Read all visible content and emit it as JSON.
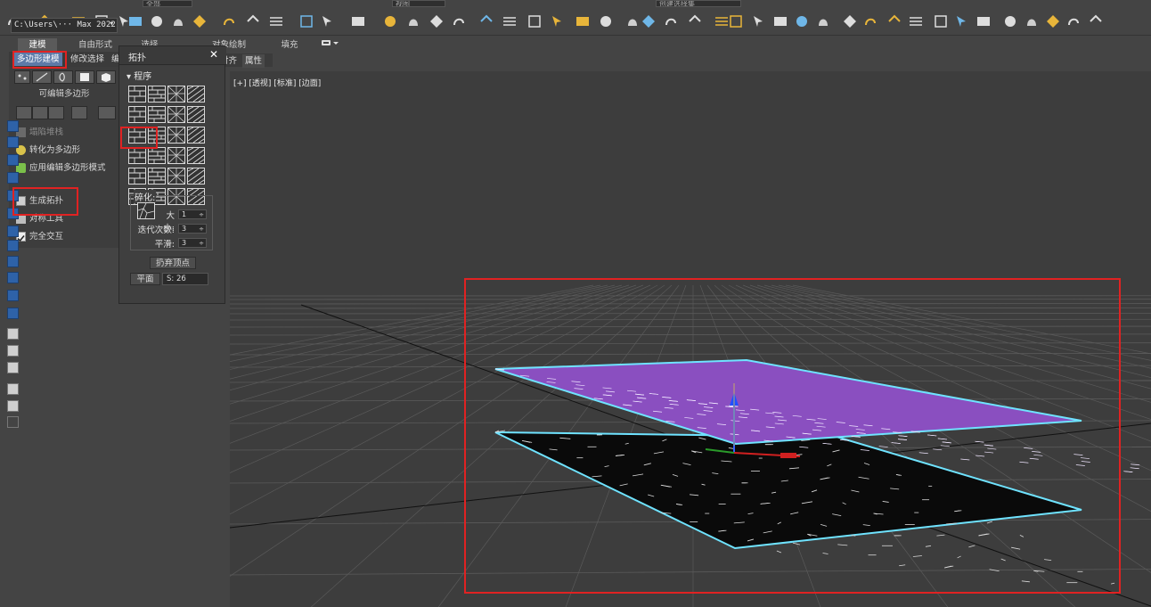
{
  "toolbar": {
    "workspace_path": "C:\\Users\\··· Max 2022",
    "workspace_arrow": "▾",
    "select_set_value": "创建选择集",
    "view_value": "视图",
    "set_value": "全部"
  },
  "ribbon": {
    "tabs": [
      "建模",
      "自由形式",
      "选择",
      "对象绘制",
      "填充"
    ],
    "active_tab": "建模",
    "sub_tabs": [
      "多边形建模",
      "修改选择",
      "编"
    ],
    "active_sub_tab": "多边形建模",
    "sub_tabs_right": [
      "对齐",
      "属性"
    ],
    "panel_title": "可编辑多边形",
    "items": [
      {
        "label": "塌陷堆栈",
        "disabled": true,
        "icon": "collapse-stack-icon"
      },
      {
        "label": "转化为多边形",
        "disabled": false,
        "icon": "convert-to-poly-icon"
      },
      {
        "label": "应用编辑多边形模式",
        "disabled": false,
        "icon": "apply-edit-poly-icon"
      },
      {
        "label": "生成拓扑",
        "disabled": false,
        "icon": "generate-topology-icon"
      },
      {
        "label": "对称工具",
        "disabled": false,
        "icon": "symmetry-tool-icon"
      },
      {
        "label": "完全交互",
        "disabled": false,
        "icon": "checkbox-icon",
        "checked": true
      }
    ]
  },
  "topology_panel": {
    "title": "拓扑",
    "close": "✕",
    "section_arrow": "▾",
    "section": "程序",
    "fracture_label": "碎化:",
    "size_label": "大小:",
    "size_value": "1",
    "iterations_label": "迭代次数:",
    "iterations_value": "3",
    "smooth_label": "平滑:",
    "smooth_value": "3",
    "discard_button": "扔弃顶点",
    "plane_button": "平面",
    "seed_value": "S: 26",
    "spinner_arrow": "÷"
  },
  "viewport": {
    "label": "[+] [透视] [标准] [边面]",
    "top_plane_color": "#8a4fc0",
    "bottom_plane_color": "#0a0a0a",
    "selection_edge_color": "#6fe3ff",
    "grid_color": "#5a5a5a"
  },
  "annotations": {
    "highlight_color": "#e02222"
  }
}
